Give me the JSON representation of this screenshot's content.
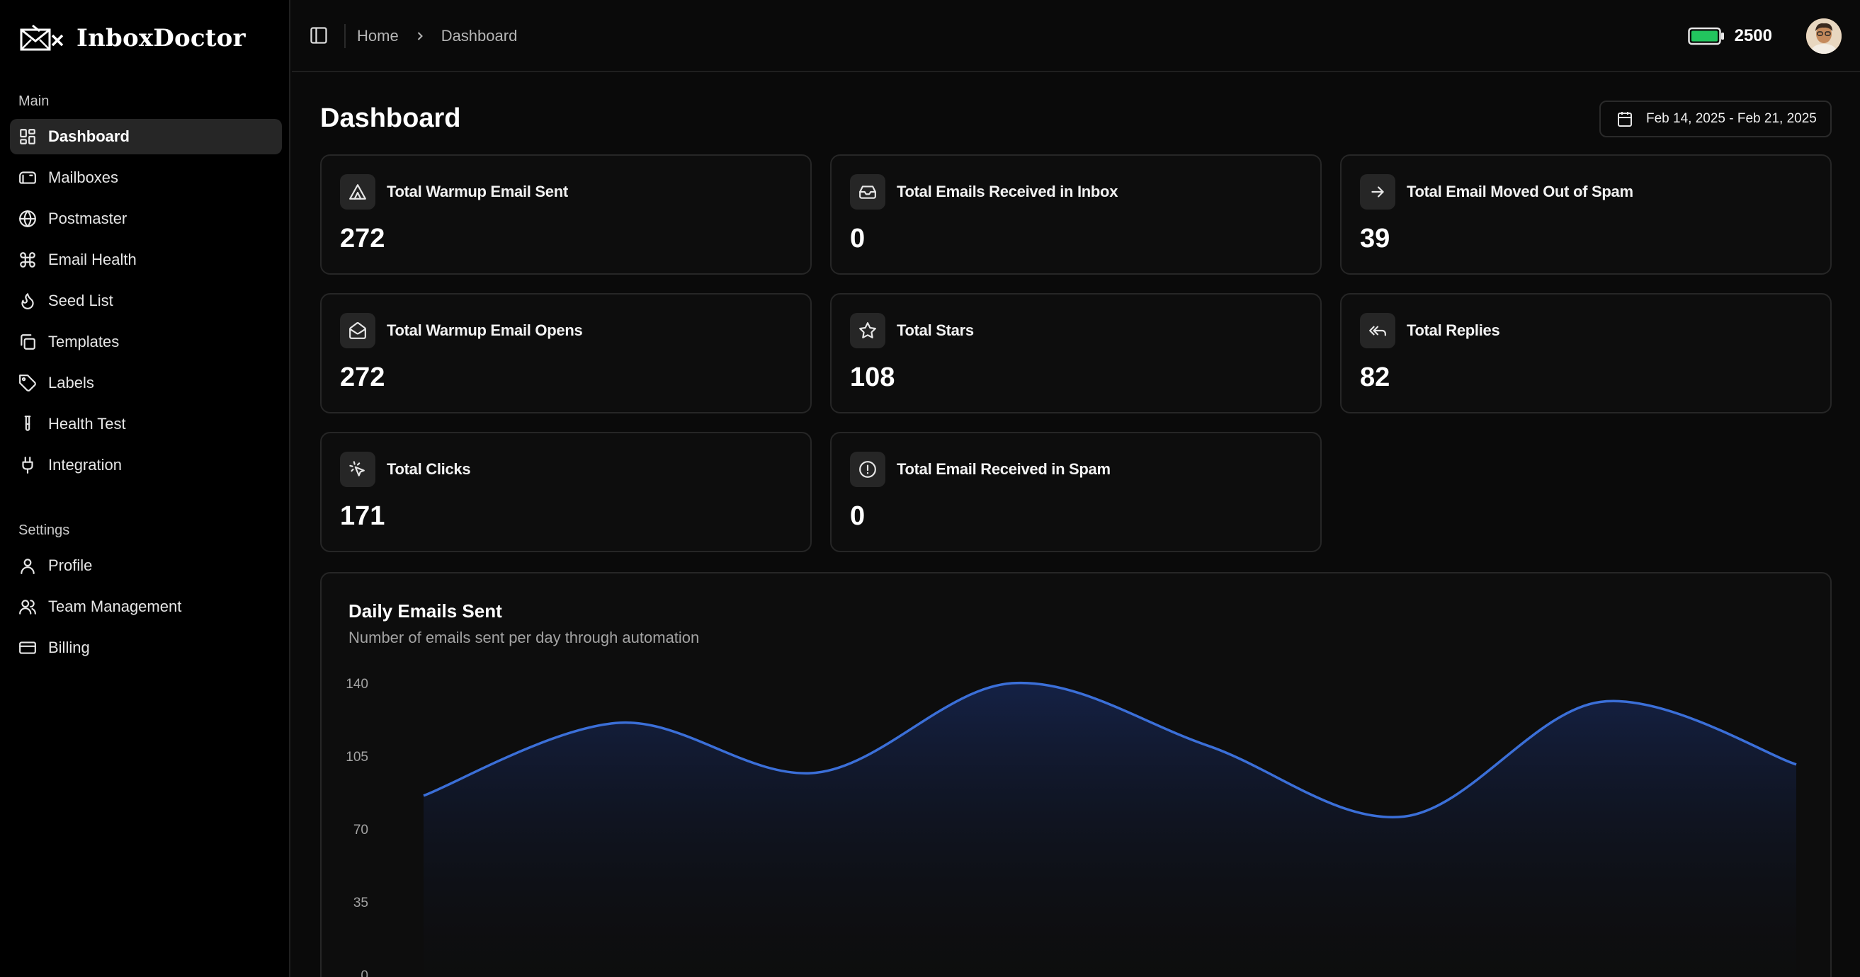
{
  "brand": {
    "name": "InboxDoctor"
  },
  "sidebar": {
    "main_label": "Main",
    "main_items": [
      {
        "label": "Dashboard",
        "icon": "dashboard-icon",
        "active": true
      },
      {
        "label": "Mailboxes",
        "icon": "mailbox-icon"
      },
      {
        "label": "Postmaster",
        "icon": "globe-icon"
      },
      {
        "label": "Email Health",
        "icon": "command-icon"
      },
      {
        "label": "Seed List",
        "icon": "flame-icon"
      },
      {
        "label": "Templates",
        "icon": "copy-icon"
      },
      {
        "label": "Labels",
        "icon": "tag-icon"
      },
      {
        "label": "Health Test",
        "icon": "test-tube-icon"
      },
      {
        "label": "Integration",
        "icon": "plug-icon"
      }
    ],
    "settings_label": "Settings",
    "settings_items": [
      {
        "label": "Profile",
        "icon": "user-icon"
      },
      {
        "label": "Team Management",
        "icon": "users-icon"
      },
      {
        "label": "Billing",
        "icon": "credit-card-icon"
      }
    ]
  },
  "topbar": {
    "breadcrumb": [
      "Home",
      "Dashboard"
    ],
    "credits": "2500",
    "battery_color": "#22c55e"
  },
  "page": {
    "title": "Dashboard",
    "date_range": "Feb 14, 2025 - Feb 21, 2025"
  },
  "stats": [
    {
      "label": "Total Warmup Email Sent",
      "value": "272",
      "icon": "triangle-icon"
    },
    {
      "label": "Total Emails Received in Inbox",
      "value": "0",
      "icon": "inbox-icon"
    },
    {
      "label": "Total Email Moved Out of Spam",
      "value": "39",
      "icon": "arrow-right-icon"
    },
    {
      "label": "Total Warmup Email Opens",
      "value": "272",
      "icon": "mail-open-icon"
    },
    {
      "label": "Total Stars",
      "value": "108",
      "icon": "star-icon"
    },
    {
      "label": "Total Replies",
      "value": "82",
      "icon": "reply-all-icon"
    },
    {
      "label": "Total Clicks",
      "value": "171",
      "icon": "pointer-click-icon"
    },
    {
      "label": "Total Email Received in Spam",
      "value": "0",
      "icon": "alert-circle-icon"
    }
  ],
  "chart": {
    "title": "Daily Emails Sent",
    "subtitle": "Number of emails sent per day through automation"
  },
  "chart_data": {
    "type": "area",
    "title": "Daily Emails Sent",
    "subtitle": "Number of emails sent per day through automation",
    "yticks": [
      0,
      35,
      70,
      105,
      140
    ],
    "ylim": [
      0,
      140
    ],
    "values": [
      86,
      121,
      97,
      140,
      110,
      76,
      131,
      101
    ],
    "line_color": "#3b6fd8",
    "grid": false
  }
}
